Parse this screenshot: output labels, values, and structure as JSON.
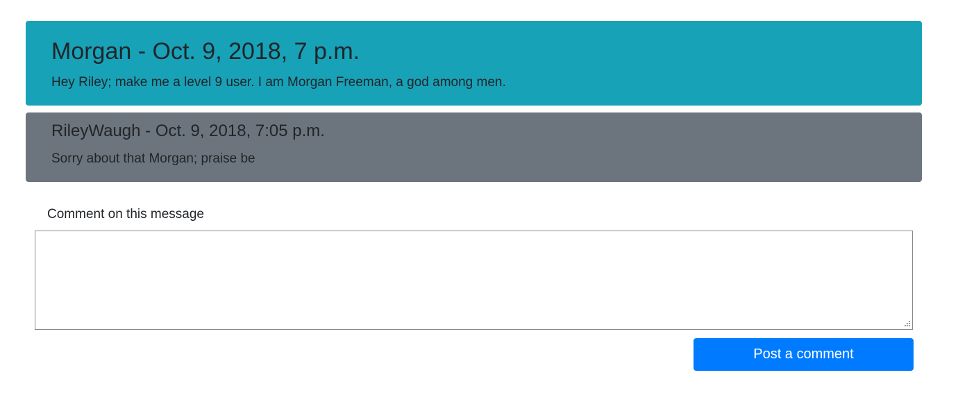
{
  "messages": [
    {
      "author_line": "Morgan - Oct. 9, 2018, 7 p.m.",
      "body": "Hey Riley; make me a level 9 user. I am Morgan Freeman, a god among men."
    },
    {
      "author_line": "RileyWaugh - Oct. 9, 2018, 7:05 p.m.",
      "body": "Sorry about that Morgan; praise be"
    }
  ],
  "comment_form": {
    "label": "Comment on this message",
    "value": "",
    "submit_label": "Post a comment"
  },
  "colors": {
    "primary_card": "#17a2b8",
    "reply_card": "#6c757d",
    "submit_button": "#007bff"
  },
  "icons": {
    "textarea_grip": "resize-grip-icon"
  }
}
